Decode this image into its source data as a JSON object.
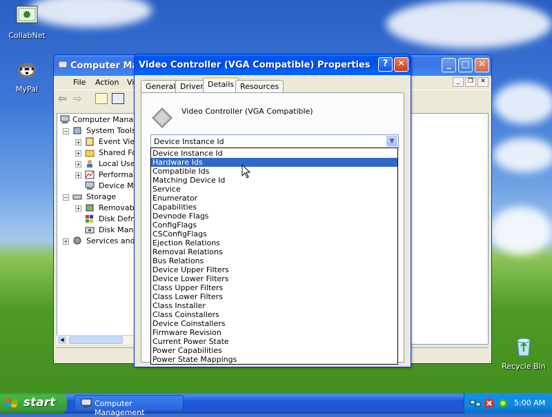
{
  "desktop": {
    "icons": [
      {
        "label": "CollabNet",
        "icon": "collabnet-icon"
      },
      {
        "label": "MyPal",
        "icon": "mypal-icon"
      },
      {
        "label": "Recycle Bin",
        "icon": "recycle-bin-icon"
      }
    ]
  },
  "background_window": {
    "title": "Computer Mana",
    "menu": [
      "File",
      "Action",
      "Vi"
    ],
    "tree": [
      {
        "label": "Computer Manage",
        "level": 0,
        "expander": ""
      },
      {
        "label": "System Tools",
        "level": 1,
        "expander": "−"
      },
      {
        "label": "Event View",
        "level": 2,
        "expander": "+"
      },
      {
        "label": "Shared Fo",
        "level": 2,
        "expander": "+"
      },
      {
        "label": "Local User",
        "level": 2,
        "expander": "+"
      },
      {
        "label": "Performan",
        "level": 2,
        "expander": "+"
      },
      {
        "label": "Device Ma",
        "level": 2,
        "expander": ""
      },
      {
        "label": "Storage",
        "level": 1,
        "expander": "−"
      },
      {
        "label": "Removable",
        "level": 2,
        "expander": "+"
      },
      {
        "label": "Disk Defra",
        "level": 2,
        "expander": ""
      },
      {
        "label": "Disk Manag",
        "level": 2,
        "expander": ""
      },
      {
        "label": "Services and A",
        "level": 1,
        "expander": "+"
      }
    ]
  },
  "dialog": {
    "title": "Video Controller (VGA Compatible) Properties",
    "help_button": "?",
    "close_button": "✕",
    "tabs": [
      "General",
      "Driver",
      "Details",
      "Resources"
    ],
    "active_tab": "Details",
    "device_name": "Video Controller (VGA Compatible)",
    "property_select": {
      "value": "Device Instance Id",
      "options": [
        "Device Instance Id",
        "Hardware Ids",
        "Compatible Ids",
        "Matching Device Id",
        "Service",
        "Enumerator",
        "Capabilities",
        "Devnode Flags",
        "ConfigFlags",
        "CSConfigFlags",
        "Ejection Relations",
        "Removal Relations",
        "Bus Relations",
        "Device Upper Filters",
        "Device Lower Filters",
        "Class Upper Filters",
        "Class Lower Filters",
        "Class Installer",
        "Class Coinstallers",
        "Device Coinstallers",
        "Firmware Revision",
        "Current Power State",
        "Power Capabilities",
        "Power State Mappings"
      ],
      "highlighted": "Hardware Ids"
    }
  },
  "taskbar": {
    "start_label": "start",
    "tasks": [
      {
        "label": "Computer Management",
        "icon": "computer-management-icon"
      }
    ],
    "clock": "5:00 AM"
  },
  "colors": {
    "xp_blue": "#0053ee",
    "selection": "#316ac5",
    "start_green": "#3a9a3a"
  }
}
